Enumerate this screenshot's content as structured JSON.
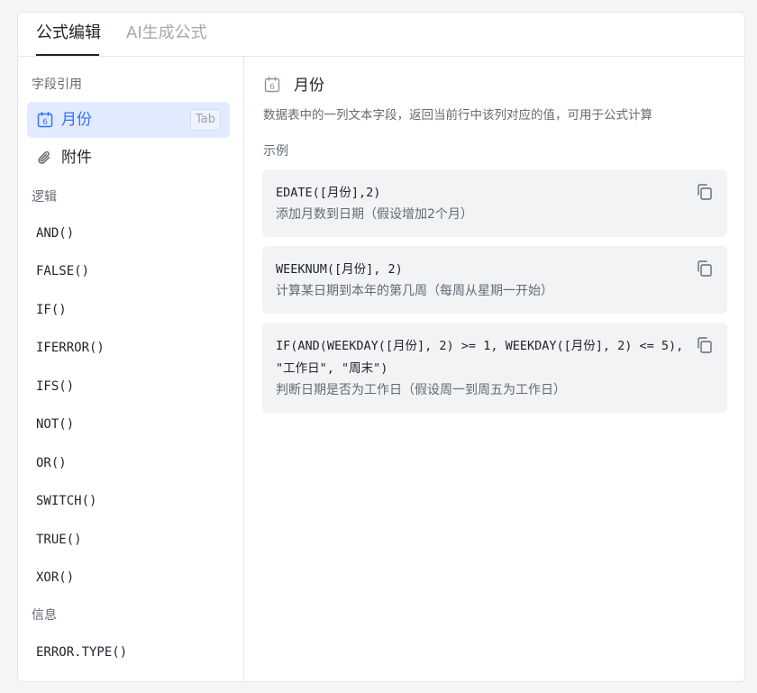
{
  "tabs": [
    {
      "label": "公式编辑",
      "active": true
    },
    {
      "label": "AI生成公式",
      "active": false
    }
  ],
  "sidebar": {
    "fields_title": "字段引用",
    "fields": [
      {
        "label": "月份",
        "icon": "calendar-icon",
        "shortcut": "Tab",
        "selected": true
      },
      {
        "label": "附件",
        "icon": "paperclip-icon",
        "selected": false
      }
    ],
    "logic_title": "逻辑",
    "logic_functions": [
      "AND()",
      "FALSE()",
      "IF()",
      "IFERROR()",
      "IFS()",
      "NOT()",
      "OR()",
      "SWITCH()",
      "TRUE()",
      "XOR()"
    ],
    "info_title": "信息",
    "info_functions": [
      "ERROR.TYPE()"
    ]
  },
  "main": {
    "field_icon": "calendar-icon",
    "field_name": "月份",
    "description": "数据表中的一列文本字段，返回当前行中该列对应的值，可用于公式计算",
    "examples_title": "示例",
    "examples": [
      {
        "code": "EDATE([月份],2)",
        "note": "添加月数到日期（假设增加2个月）"
      },
      {
        "code": "WEEKNUM([月份], 2)",
        "note": "计算某日期到本年的第几周（每周从星期一开始）"
      },
      {
        "code": "IF(AND(WEEKDAY([月份], 2) >= 1, WEEKDAY([月份], 2) <= 5), \"工作日\", \"周末\")",
        "note": "判断日期是否为工作日（假设周一到周五为工作日）"
      }
    ],
    "copy_icon": "copy-icon"
  },
  "colors": {
    "accent": "#3370ff",
    "selected_bg": "#e1eaff",
    "example_bg": "#f2f3f5",
    "muted_text": "#646a73"
  }
}
